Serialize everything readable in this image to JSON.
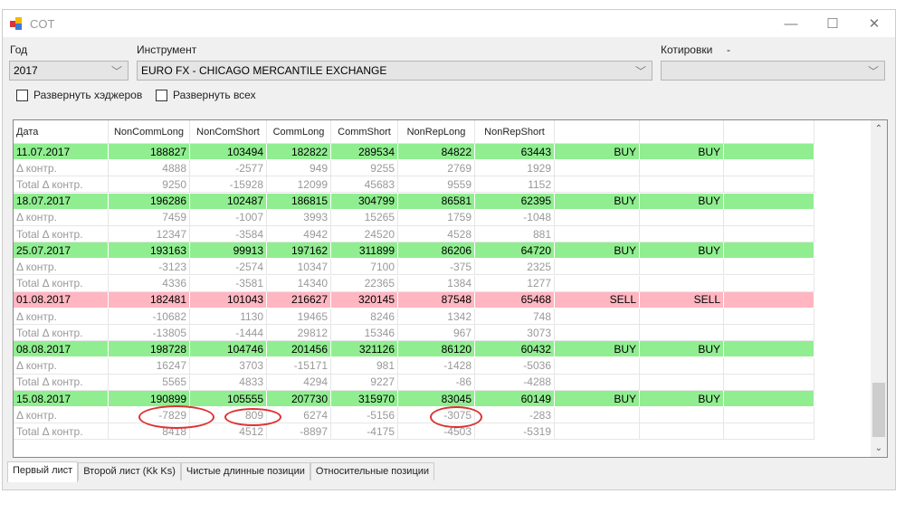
{
  "window": {
    "title": "COT",
    "minimize": "—",
    "maximize": "☐",
    "close": "✕"
  },
  "controls": {
    "year_label": "Год",
    "year_value": "2017",
    "instrument_label": "Инструмент",
    "instrument_value": "EURO FX - CHICAGO MERCANTILE EXCHANGE",
    "quotes_label": "Котировки",
    "quotes_extra": "-",
    "quotes_value": "",
    "expand_hedgers": "Развернуть хэджеров",
    "expand_all": "Развернуть всех",
    "expand_hedgers_checked": false,
    "expand_all_checked": false
  },
  "grid": {
    "columns": [
      "Дата",
      "NonCommLong",
      "NonComShort",
      "CommLong",
      "CommShort",
      "NonRepLong",
      "NonRepShort",
      "",
      "",
      ""
    ],
    "rows": [
      {
        "type": "green",
        "cells": [
          "11.07.2017",
          "188827",
          "103494",
          "182822",
          "289534",
          "84822",
          "63443",
          "BUY",
          "BUY",
          ""
        ]
      },
      {
        "type": "sub",
        "cells": [
          "Δ контр.",
          "4888",
          "-2577",
          "949",
          "9255",
          "2769",
          "1929",
          "",
          "",
          ""
        ]
      },
      {
        "type": "sub",
        "cells": [
          "Total Δ контр.",
          "9250",
          "-15928",
          "12099",
          "45683",
          "9559",
          "1152",
          "",
          "",
          ""
        ]
      },
      {
        "type": "green",
        "cells": [
          "18.07.2017",
          "196286",
          "102487",
          "186815",
          "304799",
          "86581",
          "62395",
          "BUY",
          "BUY",
          ""
        ]
      },
      {
        "type": "sub",
        "cells": [
          "Δ контр.",
          "7459",
          "-1007",
          "3993",
          "15265",
          "1759",
          "-1048",
          "",
          "",
          ""
        ]
      },
      {
        "type": "sub",
        "cells": [
          "Total Δ контр.",
          "12347",
          "-3584",
          "4942",
          "24520",
          "4528",
          "881",
          "",
          "",
          ""
        ]
      },
      {
        "type": "green",
        "cells": [
          "25.07.2017",
          "193163",
          "99913",
          "197162",
          "311899",
          "86206",
          "64720",
          "BUY",
          "BUY",
          ""
        ]
      },
      {
        "type": "sub",
        "cells": [
          "Δ контр.",
          "-3123",
          "-2574",
          "10347",
          "7100",
          "-375",
          "2325",
          "",
          "",
          ""
        ]
      },
      {
        "type": "sub",
        "cells": [
          "Total Δ контр.",
          "4336",
          "-3581",
          "14340",
          "22365",
          "1384",
          "1277",
          "",
          "",
          ""
        ]
      },
      {
        "type": "pink",
        "cells": [
          "01.08.2017",
          "182481",
          "101043",
          "216627",
          "320145",
          "87548",
          "65468",
          "SELL",
          "SELL",
          ""
        ]
      },
      {
        "type": "sub",
        "cells": [
          "Δ контр.",
          "-10682",
          "1130",
          "19465",
          "8246",
          "1342",
          "748",
          "",
          "",
          ""
        ]
      },
      {
        "type": "sub",
        "cells": [
          "Total Δ контр.",
          "-13805",
          "-1444",
          "29812",
          "15346",
          "967",
          "3073",
          "",
          "",
          ""
        ]
      },
      {
        "type": "green",
        "cells": [
          "08.08.2017",
          "198728",
          "104746",
          "201456",
          "321126",
          "86120",
          "60432",
          "BUY",
          "BUY",
          ""
        ]
      },
      {
        "type": "sub",
        "cells": [
          "Δ контр.",
          "16247",
          "3703",
          "-15171",
          "981",
          "-1428",
          "-5036",
          "",
          "",
          ""
        ]
      },
      {
        "type": "sub",
        "cells": [
          "Total Δ контр.",
          "5565",
          "4833",
          "4294",
          "9227",
          "-86",
          "-4288",
          "",
          "",
          ""
        ]
      },
      {
        "type": "green",
        "cells": [
          "15.08.2017",
          "190899",
          "105555",
          "207730",
          "315970",
          "83045",
          "60149",
          "BUY",
          "BUY",
          ""
        ]
      },
      {
        "type": "sub",
        "cells": [
          "Δ контр.",
          "-7829",
          "809",
          "6274",
          "-5156",
          "-3075",
          "-283",
          "",
          "",
          ""
        ]
      },
      {
        "type": "sub",
        "cells": [
          "Total Δ контр.",
          "8418",
          "4512",
          "-8897",
          "-4175",
          "-4503",
          "-5319",
          "",
          "",
          ""
        ]
      }
    ]
  },
  "tabs": [
    {
      "label": "Первый лист",
      "active": true
    },
    {
      "label": "Второй лист (Kk Ks)",
      "active": false
    },
    {
      "label": "Чистые длинные позиции",
      "active": false
    },
    {
      "label": "Относительные позиции",
      "active": false
    }
  ],
  "colors": {
    "buy_row": "#90ee90",
    "sell_row": "#ffb6c1",
    "annotation": "#dd3333"
  }
}
